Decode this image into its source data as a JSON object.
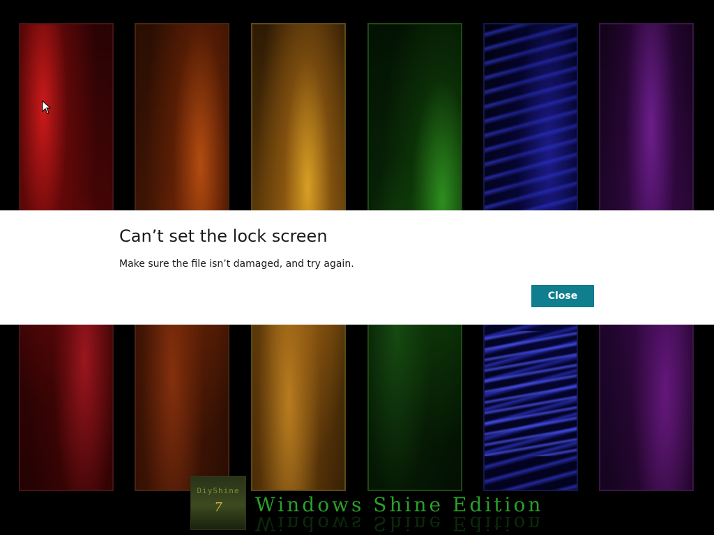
{
  "dialog": {
    "title": "Can’t set the lock screen",
    "message": "Make sure the file isn’t damaged, and try again.",
    "close_label": "Close",
    "button_color": "#0f7e8e"
  },
  "wallpaper": {
    "logo_title": "DiyShine",
    "logo_number": "7",
    "edition_text": "Windows Shine Edition",
    "panel_colors": [
      "#c21010",
      "#c24a10",
      "#d8a020",
      "#2a9a1a",
      "#2020c0",
      "#8a2aa8"
    ]
  },
  "cursor": {
    "icon": "arrow-pointer-icon"
  }
}
